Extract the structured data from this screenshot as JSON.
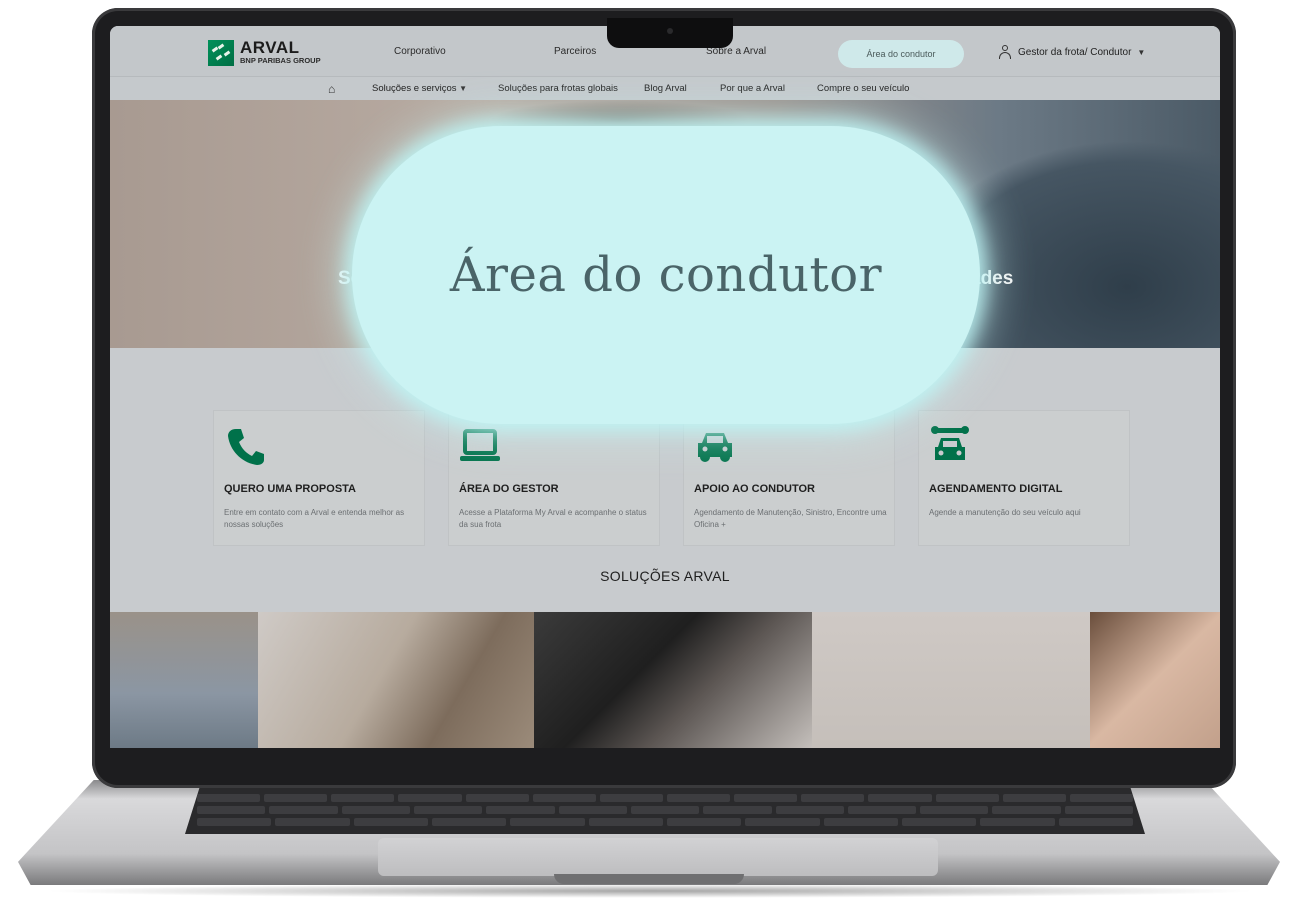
{
  "colors": {
    "brand_green": "#00915a",
    "callout_bg": "#cbf3f3",
    "callout_text": "#4a6468",
    "pill_bg": "#cfe9ea"
  },
  "brand": {
    "name": "ARVAL",
    "subtitle": "BNP PARIBAS GROUP"
  },
  "topnav": {
    "links": [
      "Corporativo",
      "Parceiros",
      "Sobre a Arval"
    ],
    "driver_area": "Área do condutor",
    "user_menu": "Gestor da frota/ Condutor"
  },
  "mainnav": {
    "home_icon": "home-icon",
    "links": [
      "Soluções e serviços",
      "Soluções para frotas globais",
      "Blog Arval",
      "Por que a Arval",
      "Compre o seu veículo"
    ]
  },
  "hero": {
    "left_text": "Sol",
    "right_text": "ades"
  },
  "cards": [
    {
      "icon": "phone-icon",
      "title": "QUERO UMA PROPOSTA",
      "description": "Entre em contato com a Arval e entenda melhor as nossas soluções"
    },
    {
      "icon": "laptop-icon",
      "title": "ÁREA DO GESTOR",
      "description": "Acesse a Plataforma My Arval e acompanhe o status da sua frota"
    },
    {
      "icon": "car-icon",
      "title": "APOIO AO CONDUTOR",
      "description": "Agendamento de Manutenção, Sinistro, Encontre uma Oficina +"
    },
    {
      "icon": "car-service-icon",
      "title": "AGENDAMENTO DIGITAL",
      "description": "Agende a manutenção do seu veículo aqui"
    }
  ],
  "section": {
    "title": "SOLUÇÕES ARVAL"
  },
  "callout": {
    "text": "Área do condutor"
  }
}
